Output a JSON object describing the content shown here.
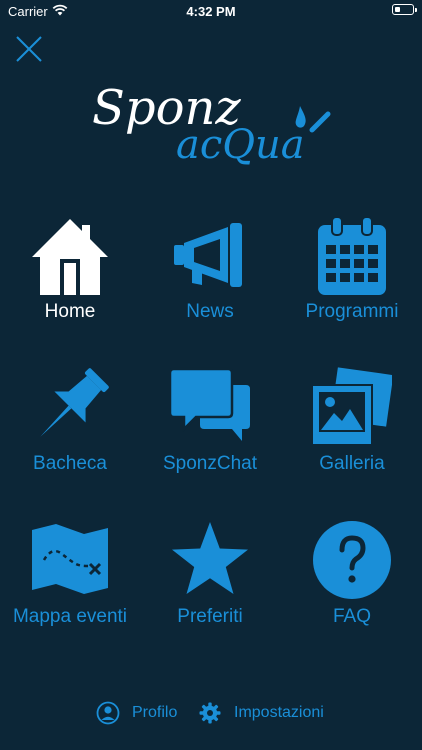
{
  "status_bar": {
    "carrier": "Carrier",
    "time": "4:32 PM"
  },
  "logo": {
    "line1": "Sponz",
    "line2": "acQua"
  },
  "menu": {
    "home": "Home",
    "news": "News",
    "programmi": "Programmi",
    "bacheca": "Bacheca",
    "sponzchat": "SponzChat",
    "galleria": "Galleria",
    "mappa": "Mappa eventi",
    "preferiti": "Preferiti",
    "faq": "FAQ"
  },
  "footer": {
    "profilo": "Profilo",
    "impostazioni": "Impostazioni"
  },
  "colors": {
    "background": "#0c2637",
    "accent": "#1a8fd8",
    "active": "#ffffff"
  }
}
